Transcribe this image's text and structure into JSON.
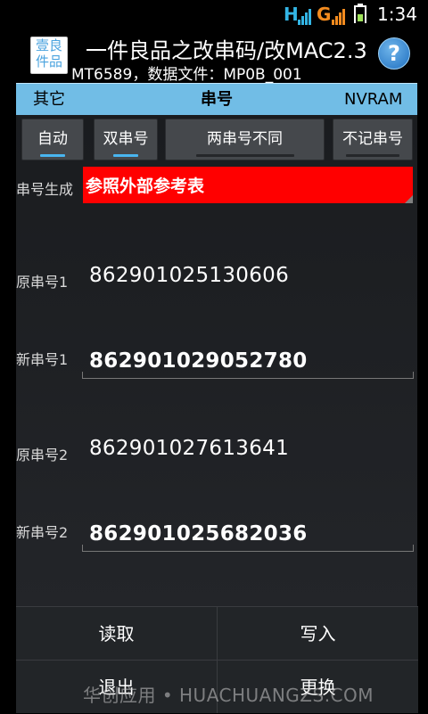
{
  "status_bar": {
    "network_h": "H",
    "network_g": "G",
    "time": "1:34"
  },
  "app": {
    "logo_text_line1": "壹良",
    "logo_text_line2": "件品",
    "title": "一件良品之改串码/改MAC2.3",
    "subtitle": "MT6589，数据文件：MP0B_001",
    "help_label": "?"
  },
  "tabs": [
    {
      "label": "其它"
    },
    {
      "label": "串号"
    },
    {
      "label": "NVRAM"
    }
  ],
  "modes": [
    {
      "label": "自动"
    },
    {
      "label": "双串号"
    },
    {
      "label": "两串号不同"
    },
    {
      "label": "不记串号"
    }
  ],
  "generation": {
    "label": "串号生成",
    "value": "参照外部参考表"
  },
  "serials": [
    {
      "label": "原串号1",
      "value": "862901025130606"
    },
    {
      "label": "新串号1",
      "value": "862901029052780"
    },
    {
      "label": "原串号2",
      "value": "862901027613641"
    },
    {
      "label": "新串号2",
      "value": "862901025682036"
    }
  ],
  "buttons": {
    "read": "读取",
    "write": "写入",
    "exit": "退出",
    "replace": "更换"
  },
  "watermark": "华创应用 • HUACHUANGZS.COM",
  "colors": {
    "tab_bar": "#71bde6",
    "red_box": "#ff0000",
    "indicator": "#49b5ef",
    "help_icon": "#1f6fc0"
  }
}
